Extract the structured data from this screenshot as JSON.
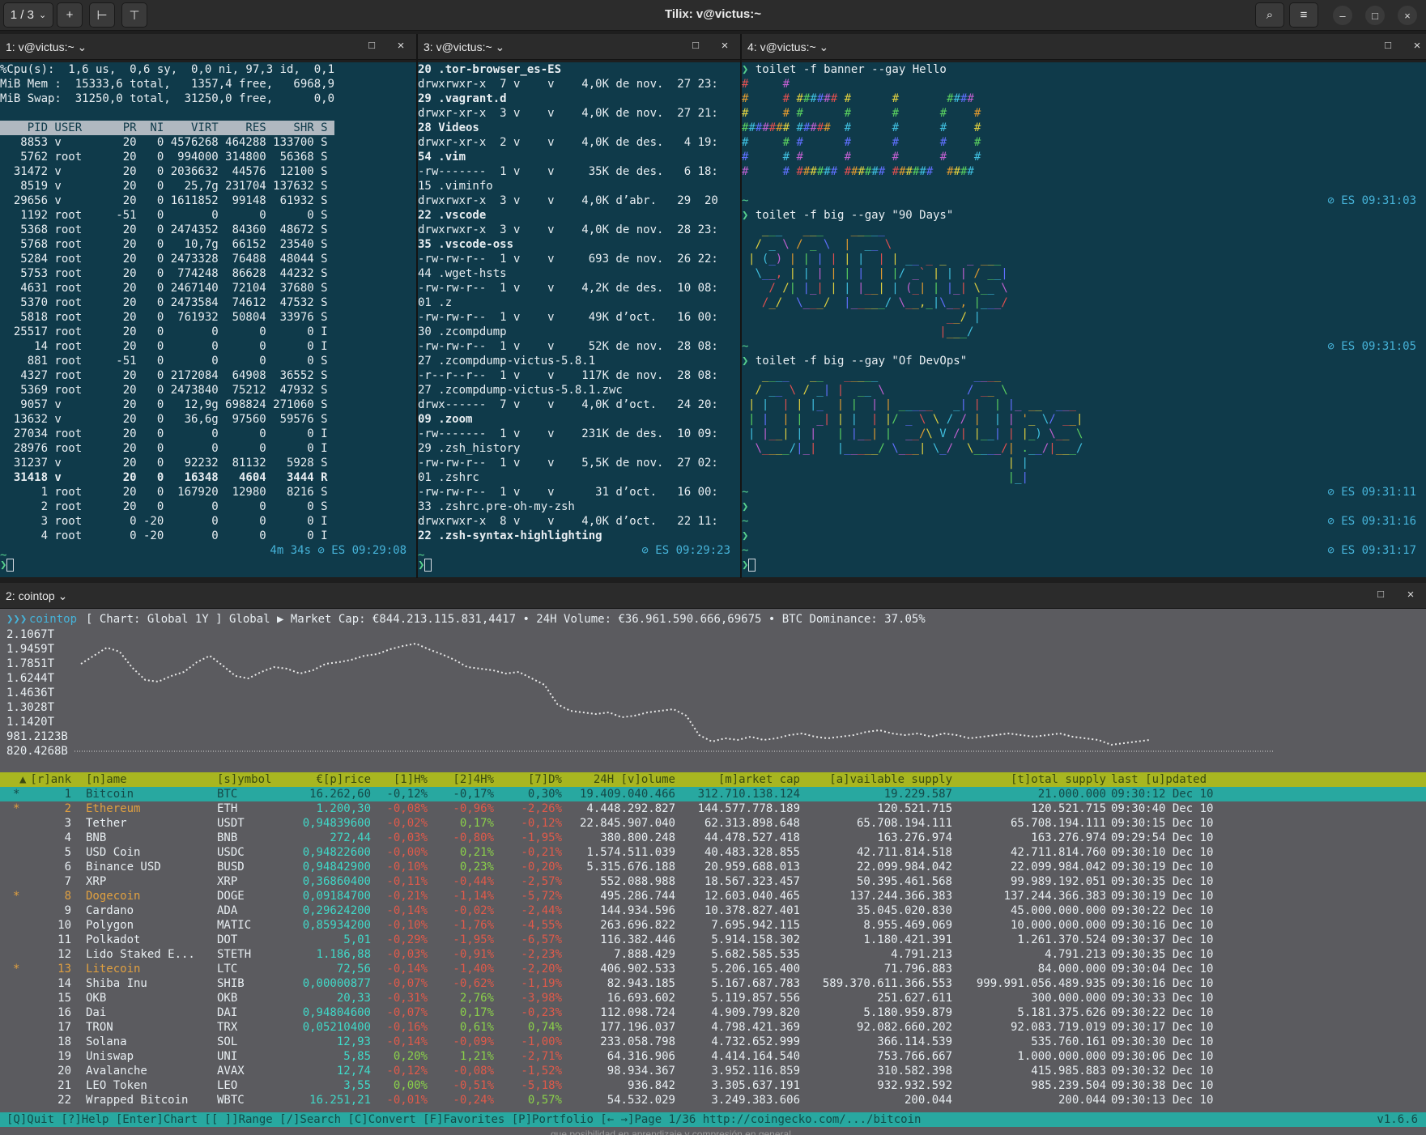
{
  "header": {
    "session_label": "1 / 3",
    "title": "Tilix: v@victus:~"
  },
  "panes": {
    "p1": {
      "title": "1: v@victus:~"
    },
    "p3": {
      "title": "3: v@victus:~"
    },
    "p4": {
      "title": "4: v@victus:~"
    },
    "p2": {
      "title": "2: cointop"
    }
  },
  "top": {
    "summary": [
      "%Cpu(s):  1,6 us,  0,6 sy,  0,0 ni, 97,3 id,  0,1",
      "MiB Mem :  15333,6 total,   1357,4 free,   6968,9",
      "MiB Swap:  31250,0 total,  31250,0 free,      0,0"
    ],
    "header": "    PID USER      PR  NI    VIRT    RES    SHR S ",
    "rows": [
      "   8853 v         20   0 4576268 464288 133700 S",
      "   5762 root      20   0  994000 314800  56368 S",
      "  31472 v         20   0 2036632  44576  12100 S",
      "   8519 v         20   0   25,7g 231704 137632 S",
      "  29656 v         20   0 1611852  99148  61932 S",
      "   1192 root     -51   0       0      0      0 S",
      "   5368 root      20   0 2474352  84360  48672 S",
      "   5768 root      20   0   10,7g  66152  23540 S",
      "   5284 root      20   0 2473328  76488  48044 S",
      "   5753 root      20   0  774248  86628  44232 S",
      "   4631 root      20   0 2467140  72104  37680 S",
      "   5370 root      20   0 2473584  74612  47532 S",
      "   5818 root      20   0  761932  50804  33976 S",
      "  25517 root      20   0       0      0      0 I",
      "     14 root      20   0       0      0      0 I",
      "    881 root     -51   0       0      0      0 S",
      "   4327 root      20   0 2172084  64908  36552 S",
      "   5369 root      20   0 2473840  75212  47932 S",
      "   9057 v         20   0   12,9g 698824 271060 S",
      "  13632 v         20   0   36,6g  97560  59576 S",
      "  27034 root      20   0       0      0      0 I",
      "  28976 root      20   0       0      0      0 I",
      "  31237 v         20   0   92232  81132   5928 S",
      "  31418 v         20   0   16348   4604   3444 R",
      "      1 root      20   0  167920  12980   8216 S",
      "      2 root      20   0       0      0      0 S",
      "      3 root       0 -20       0      0      0 I",
      "      4 root       0 -20       0      0      0 I"
    ],
    "status": "4m 34s ⊘ ES 09:29:08"
  },
  "ls": {
    "lines": [
      "20 .tor-browser_es-ES",
      "drwxrwxr-x  7 v    v    4,0K de nov.  27 23:",
      "29 .vagrant.d",
      "drwxr-xr-x  3 v    v    4,0K de nov.  27 21:",
      "28 Videos",
      "drwxr-xr-x  2 v    v    4,0K de des.   4 19:",
      "54 .vim",
      "-rw-------  1 v    v     35K de des.   6 18:",
      "15 .viminfo",
      "drwxrwxr-x  3 v    v    4,0K d’abr.   29  20",
      "22 .vscode",
      "drwxrwxr-x  3 v    v    4,0K de nov.  28 23:",
      "35 .vscode-oss",
      "-rw-rw-r--  1 v    v     693 de nov.  26 22:",
      "44 .wget-hsts",
      "-rw-rw-r--  1 v    v    4,2K de des.  10 08:",
      "01 .z",
      "-rw-rw-r--  1 v    v     49K d’oct.   16 00:",
      "30 .zcompdump",
      "-rw-rw-r--  1 v    v     52K de nov.  28 08:",
      "27 .zcompdump-victus-5.8.1",
      "-r--r--r--  1 v    v    117K de nov.  28 08:",
      "27 .zcompdump-victus-5.8.1.zwc",
      "drwx------  7 v    v    4,0K d’oct.   24 20:",
      "09 .zoom",
      "-rw-------  1 v    v    231K de des.  10 09:",
      "29 .zsh_history",
      "-rw-rw-r--  1 v    v    5,5K de nov.  27 02:",
      "01 .zshrc",
      "-rw-rw-r--  1 v    v      31 d’oct.   16 00:",
      "33 .zshrc.pre-oh-my-zsh",
      "drwxrwxr-x  8 v    v    4,0K d’oct.   22 11:",
      "22 .zsh-syntax-highlighting"
    ],
    "status": "⊘ ES 09:29:23"
  },
  "toilet": {
    "cmd1": "toilet -f banner --gay Hello",
    "hello": [
      "#     #",
      "#     # ###### #      #       ####",
      "#     # #      #      #      #    #",
      "####### #####  #      #      #    #",
      "#     # #      #      #      #    #",
      "#     # #      #      #      #    #",
      "#     # ###### ###### ######  ####"
    ],
    "status1": "⊘ ES 09:31:03",
    "cmd2": "toilet -f big --gay \"90 Days\"",
    "days": [
      "  ___   ___    _____",
      " / _ \\ / _ \\  |  __ \\",
      "| (_) | | | | | |  | | __ _ _   _ ___",
      " \\__, | | | | | |  | |/ _` | | | / __|",
      "   / /| |_| | | |__| | (_| | |_| \\__ \\",
      "  /_/  \\___/  |_____/ \\__,_|\\__, |___/",
      "                             __/ |",
      "                            |___/"
    ],
    "status2": "⊘ ES 09:31:05",
    "cmd3": "toilet -f big --gay \"Of DevOps\"",
    "devops": [
      "  ____   __   _____              ____",
      " / __ \\ / _| |  __ \\            / __ \\",
      "| |  | | |_  | |  | | _____   _| |  | |_ __  ___",
      "| |  | |  _| | |  | |/ _ \\ \\ / / |  | | '_ \\/ __|",
      "| |__| | |   | |__| |  __/\\ V /| |__| | |_) \\__ \\",
      " \\____/|_|   |_____/ \\___| \\_/  \\____/| .__/|___/",
      "                                      | |",
      "                                      |_|"
    ],
    "status3": "⊘ ES 09:31:11",
    "status4": "⊘ ES 09:31:16",
    "status5": "⊘ ES 09:31:17"
  },
  "cointop": {
    "topline": "[ Chart: Global 1Y ] Global ▶ Market Cap: €844.213.115.831,4417 • 24H Volume: €36.961.590.666,69675 • BTC Dominance: 37.05%",
    "brand": "cointop",
    "chart_labels": [
      "2.1067T",
      "1.9459T",
      "1.7851T",
      "1.6244T",
      "1.4636T",
      "1.3028T",
      "1.1420T",
      "981.2123B",
      "820.4268B"
    ],
    "columns": [
      "[r]ank",
      "[n]ame",
      "[s]ymbol",
      "€[p]rice",
      "[1]H%",
      "[2]4H%",
      "[7]D%",
      "24H [v]olume",
      "[m]arket cap",
      "[a]vailable supply",
      "[t]otal supply",
      "last [u]pdated"
    ],
    "rows": [
      {
        "fav": "*",
        "rank": "1",
        "name": "Bitcoin",
        "sym": "BTC",
        "price": "16.262,60",
        "h1": "-0,12%",
        "h24": "-0,17%",
        "d7": "0,30%",
        "vol": "19.409.040.466",
        "cap": "312.710.138.124",
        "avail": "19.229.587",
        "total": "21.000.000",
        "upd": "09:30:12 Dec 10"
      },
      {
        "fav": "*",
        "rank": "2",
        "name": "Ethereum",
        "sym": "ETH",
        "price": "1.200,30",
        "h1": "-0,08%",
        "h24": "-0,96%",
        "d7": "-2,26%",
        "vol": "4.448.292.827",
        "cap": "144.577.778.189",
        "avail": "120.521.715",
        "total": "120.521.715",
        "upd": "09:30:40 Dec 10"
      },
      {
        "fav": "",
        "rank": "3",
        "name": "Tether",
        "sym": "USDT",
        "price": "0,94839600",
        "h1": "-0,02%",
        "h24": "0,17%",
        "d7": "-0,12%",
        "vol": "22.845.907.040",
        "cap": "62.313.898.648",
        "avail": "65.708.194.111",
        "total": "65.708.194.111",
        "upd": "09:30:15 Dec 10"
      },
      {
        "fav": "",
        "rank": "4",
        "name": "BNB",
        "sym": "BNB",
        "price": "272,44",
        "h1": "-0,03%",
        "h24": "-0,80%",
        "d7": "-1,95%",
        "vol": "380.800.248",
        "cap": "44.478.527.418",
        "avail": "163.276.974",
        "total": "163.276.974",
        "upd": "09:29:54 Dec 10"
      },
      {
        "fav": "",
        "rank": "5",
        "name": "USD Coin",
        "sym": "USDC",
        "price": "0,94822600",
        "h1": "-0,00%",
        "h24": "0,21%",
        "d7": "-0,21%",
        "vol": "1.574.511.039",
        "cap": "40.483.328.855",
        "avail": "42.711.814.518",
        "total": "42.711.814.760",
        "upd": "09:30:10 Dec 10"
      },
      {
        "fav": "",
        "rank": "6",
        "name": "Binance USD",
        "sym": "BUSD",
        "price": "0,94842900",
        "h1": "-0,10%",
        "h24": "0,23%",
        "d7": "-0,20%",
        "vol": "5.315.676.188",
        "cap": "20.959.688.013",
        "avail": "22.099.984.042",
        "total": "22.099.984.042",
        "upd": "09:30:19 Dec 10"
      },
      {
        "fav": "",
        "rank": "7",
        "name": "XRP",
        "sym": "XRP",
        "price": "0,36860400",
        "h1": "-0,11%",
        "h24": "-0,44%",
        "d7": "-2,57%",
        "vol": "552.088.988",
        "cap": "18.567.323.457",
        "avail": "50.395.461.568",
        "total": "99.989.192.051",
        "upd": "09:30:35 Dec 10"
      },
      {
        "fav": "*",
        "rank": "8",
        "name": "Dogecoin",
        "sym": "DOGE",
        "price": "0,09184700",
        "h1": "-0,21%",
        "h24": "-1,14%",
        "d7": "-5,72%",
        "vol": "495.286.744",
        "cap": "12.603.040.465",
        "avail": "137.244.366.383",
        "total": "137.244.366.383",
        "upd": "09:30:19 Dec 10"
      },
      {
        "fav": "",
        "rank": "9",
        "name": "Cardano",
        "sym": "ADA",
        "price": "0,29624200",
        "h1": "-0,14%",
        "h24": "-0,02%",
        "d7": "-2,44%",
        "vol": "144.934.596",
        "cap": "10.378.827.401",
        "avail": "35.045.020.830",
        "total": "45.000.000.000",
        "upd": "09:30:22 Dec 10"
      },
      {
        "fav": "",
        "rank": "10",
        "name": "Polygon",
        "sym": "MATIC",
        "price": "0,85934200",
        "h1": "-0,10%",
        "h24": "-1,76%",
        "d7": "-4,55%",
        "vol": "263.696.822",
        "cap": "7.695.942.115",
        "avail": "8.955.469.069",
        "total": "10.000.000.000",
        "upd": "09:30:16 Dec 10"
      },
      {
        "fav": "",
        "rank": "11",
        "name": "Polkadot",
        "sym": "DOT",
        "price": "5,01",
        "h1": "-0,29%",
        "h24": "-1,95%",
        "d7": "-6,57%",
        "vol": "116.382.446",
        "cap": "5.914.158.302",
        "avail": "1.180.421.391",
        "total": "1.261.370.524",
        "upd": "09:30:37 Dec 10"
      },
      {
        "fav": "",
        "rank": "12",
        "name": "Lido Staked E...",
        "sym": "STETH",
        "price": "1.186,88",
        "h1": "-0,03%",
        "h24": "-0,91%",
        "d7": "-2,23%",
        "vol": "7.888.429",
        "cap": "5.682.585.535",
        "avail": "4.791.213",
        "total": "4.791.213",
        "upd": "09:30:35 Dec 10"
      },
      {
        "fav": "*",
        "rank": "13",
        "name": "Litecoin",
        "sym": "LTC",
        "price": "72,56",
        "h1": "-0,14%",
        "h24": "-1,40%",
        "d7": "-2,20%",
        "vol": "406.902.533",
        "cap": "5.206.165.400",
        "avail": "71.796.883",
        "total": "84.000.000",
        "upd": "09:30:04 Dec 10"
      },
      {
        "fav": "",
        "rank": "14",
        "name": "Shiba Inu",
        "sym": "SHIB",
        "price": "0,00000877",
        "h1": "-0,07%",
        "h24": "-0,62%",
        "d7": "-1,19%",
        "vol": "82.943.185",
        "cap": "5.167.687.783",
        "avail": "589.370.611.366.553",
        "total": "999.991.056.489.935",
        "upd": "09:30:16 Dec 10"
      },
      {
        "fav": "",
        "rank": "15",
        "name": "OKB",
        "sym": "OKB",
        "price": "20,33",
        "h1": "-0,31%",
        "h24": "2,76%",
        "d7": "-3,98%",
        "vol": "16.693.602",
        "cap": "5.119.857.556",
        "avail": "251.627.611",
        "total": "300.000.000",
        "upd": "09:30:33 Dec 10"
      },
      {
        "fav": "",
        "rank": "16",
        "name": "Dai",
        "sym": "DAI",
        "price": "0,94804600",
        "h1": "-0,07%",
        "h24": "0,17%",
        "d7": "-0,23%",
        "vol": "112.098.724",
        "cap": "4.909.799.820",
        "avail": "5.180.959.879",
        "total": "5.181.375.626",
        "upd": "09:30:22 Dec 10"
      },
      {
        "fav": "",
        "rank": "17",
        "name": "TRON",
        "sym": "TRX",
        "price": "0,05210400",
        "h1": "-0,16%",
        "h24": "0,61%",
        "d7": "0,74%",
        "vol": "177.196.037",
        "cap": "4.798.421.369",
        "avail": "92.082.660.202",
        "total": "92.083.719.019",
        "upd": "09:30:17 Dec 10"
      },
      {
        "fav": "",
        "rank": "18",
        "name": "Solana",
        "sym": "SOL",
        "price": "12,93",
        "h1": "-0,14%",
        "h24": "-0,09%",
        "d7": "-1,00%",
        "vol": "233.058.798",
        "cap": "4.732.652.999",
        "avail": "366.114.539",
        "total": "535.760.161",
        "upd": "09:30:30 Dec 10"
      },
      {
        "fav": "",
        "rank": "19",
        "name": "Uniswap",
        "sym": "UNI",
        "price": "5,85",
        "h1": "0,20%",
        "h24": "1,21%",
        "d7": "-2,71%",
        "vol": "64.316.906",
        "cap": "4.414.164.540",
        "avail": "753.766.667",
        "total": "1.000.000.000",
        "upd": "09:30:06 Dec 10"
      },
      {
        "fav": "",
        "rank": "20",
        "name": "Avalanche",
        "sym": "AVAX",
        "price": "12,74",
        "h1": "-0,12%",
        "h24": "-0,08%",
        "d7": "-1,52%",
        "vol": "98.934.367",
        "cap": "3.952.116.859",
        "avail": "310.582.398",
        "total": "415.985.883",
        "upd": "09:30:32 Dec 10"
      },
      {
        "fav": "",
        "rank": "21",
        "name": "LEO Token",
        "sym": "LEO",
        "price": "3,55",
        "h1": "0,00%",
        "h24": "-0,51%",
        "d7": "-5,18%",
        "vol": "936.842",
        "cap": "3.305.637.191",
        "avail": "932.932.592",
        "total": "985.239.504",
        "upd": "09:30:38 Dec 10"
      },
      {
        "fav": "",
        "rank": "22",
        "name": "Wrapped Bitcoin",
        "sym": "WBTC",
        "price": "16.251,21",
        "h1": "-0,01%",
        "h24": "-0,24%",
        "d7": "0,57%",
        "vol": "54.532.029",
        "cap": "3.249.383.606",
        "avail": "200.044",
        "total": "200.044",
        "upd": "09:30:13 Dec 10"
      }
    ],
    "footer": "[Q]Quit [?]Help [Enter]Chart [[ ]]Range [/]Search [C]Convert [F]Favorites [P]Portfolio [← →]Page 1/36 http://coingecko.com/.../bitcoin",
    "version": "v1.6.6",
    "below": "que posibilidad en aprendizaje y compresión en general"
  }
}
